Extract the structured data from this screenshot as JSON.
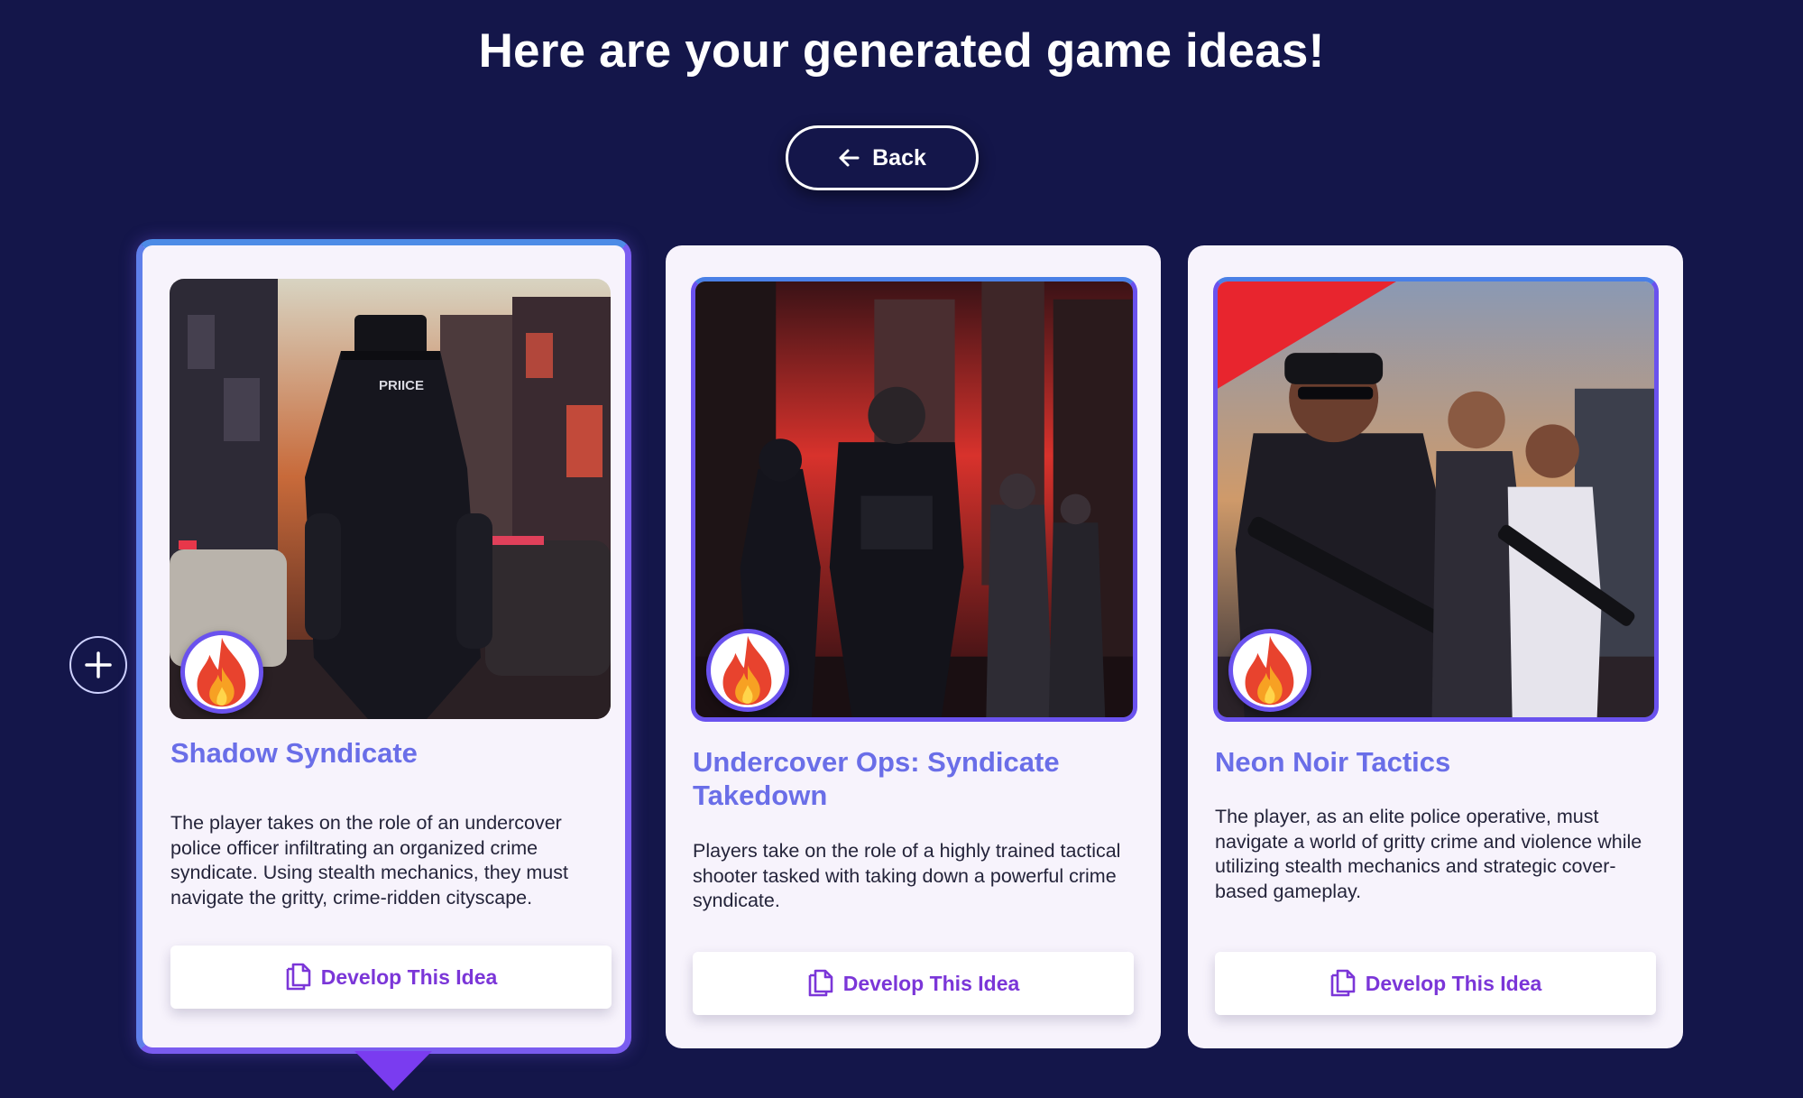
{
  "page": {
    "title": "Here are your generated game ideas!",
    "back_label": "Back"
  },
  "colors": {
    "background": "#14164a",
    "accent_purple": "#7a5cf0",
    "title_blue": "#6a6ee8",
    "button_text": "#7b36d8"
  },
  "icons": {
    "back": "arrow-left-icon",
    "add": "plus-icon",
    "badge": "fire-icon",
    "develop": "copy-icon"
  },
  "cards": [
    {
      "title": "Shadow Syndicate",
      "description": "The player takes on the role of an undercover police officer infiltrating an organized crime syndicate. Using stealth mechanics, they must navigate the gritty, crime-ridden cityscape.",
      "button_label": "Develop This Idea",
      "selected": true,
      "image_text": "PRIICE"
    },
    {
      "title": "Undercover Ops: Syndicate Takedown",
      "description": "Players take on the role of a highly trained tactical shooter tasked with taking down a powerful crime syndicate.",
      "button_label": "Develop This Idea",
      "selected": false
    },
    {
      "title": "Neon Noir Tactics",
      "description": "The player, as an elite police operative, must navigate a world of gritty crime and violence while utilizing stealth mechanics and strategic cover-based gameplay.",
      "button_label": "Develop This Idea",
      "selected": false
    }
  ]
}
